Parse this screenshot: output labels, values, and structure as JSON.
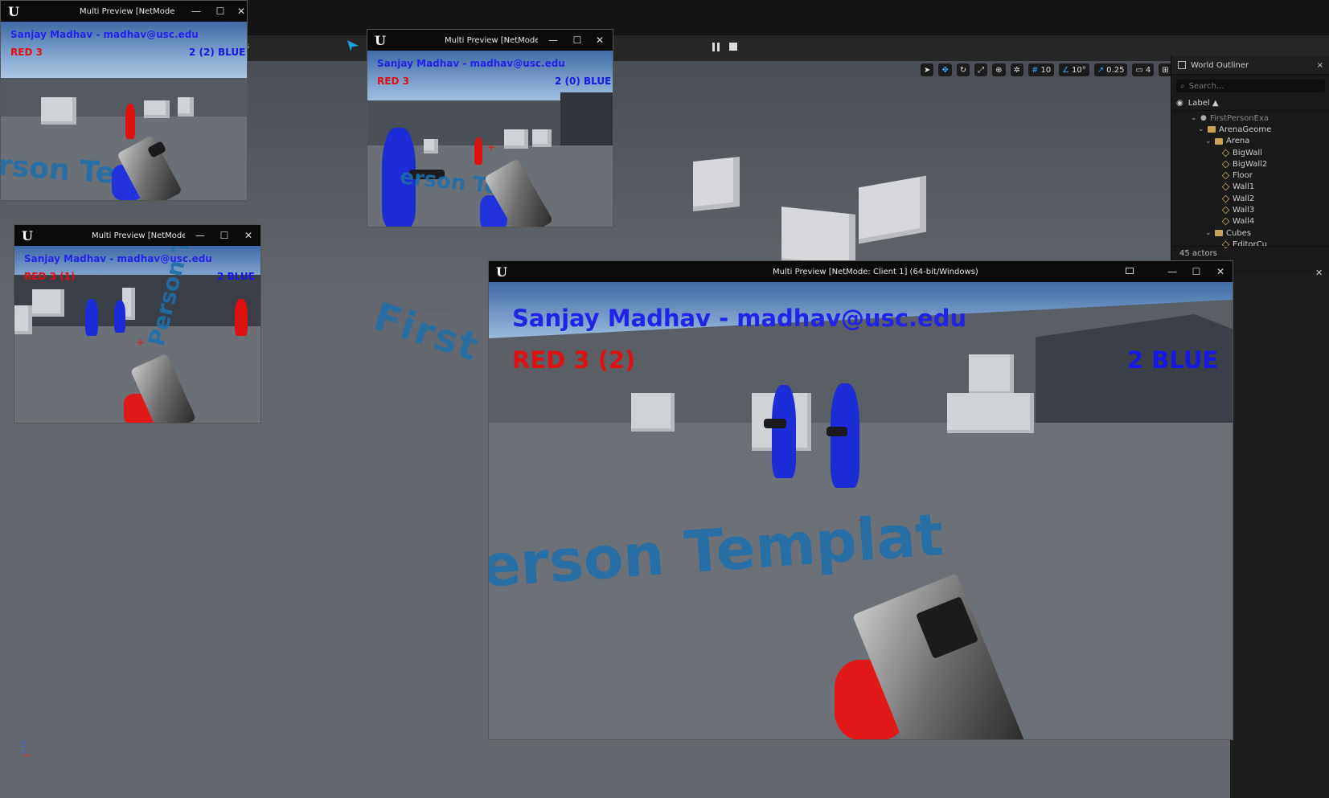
{
  "editor": {
    "toolbar": {
      "tab_fragment": "s",
      "pause_icon": "pause-icon",
      "stop_icon": "stop-icon"
    },
    "viewport": {
      "floor_text": "First P",
      "tools": {
        "grid_snap": "10",
        "rotation_snap": "10°",
        "scale_snap": "0.25",
        "camera_speed": "4"
      },
      "axis_z": "Z"
    },
    "outliner": {
      "title": "World Outliner",
      "close": "×",
      "search_placeholder": "Search...",
      "label_header": "Label ▲",
      "items": [
        {
          "label": "FirstPersonExa",
          "type": "world",
          "depth": 0,
          "expanded": true
        },
        {
          "label": "ArenaGeome",
          "type": "folder",
          "depth": 1,
          "expanded": true
        },
        {
          "label": "Arena",
          "type": "folder",
          "depth": 2,
          "expanded": true
        },
        {
          "label": "BigWall",
          "type": "mesh",
          "depth": 3
        },
        {
          "label": "BigWall2",
          "type": "mesh",
          "depth": 3
        },
        {
          "label": "Floor",
          "type": "mesh",
          "depth": 3
        },
        {
          "label": "Wall1",
          "type": "mesh",
          "depth": 3
        },
        {
          "label": "Wall2",
          "type": "mesh",
          "depth": 3
        },
        {
          "label": "Wall3",
          "type": "mesh",
          "depth": 3
        },
        {
          "label": "Wall4",
          "type": "mesh",
          "depth": 3
        },
        {
          "label": "Cubes",
          "type": "folder",
          "depth": 2,
          "expanded": true
        },
        {
          "label": "EditorCu",
          "type": "mesh",
          "depth": 3
        }
      ],
      "actor_count": "45 actors"
    }
  },
  "windows": {
    "w1": {
      "title": "Multi Preview [NetMode: Cli",
      "name": "Sanjay Madhav - madhav@usc.edu",
      "red": "RED  3",
      "blue": "2 (2)  BLUE",
      "floor_text": "rson Temp"
    },
    "w2": {
      "title": "Multi Preview [NetMode: Cli",
      "name": "Sanjay Madhav - madhav@usc.edu",
      "red": "RED  3",
      "blue": "2 (0)  BLUE",
      "floor_text": "erson Tem"
    },
    "w3": {
      "title": "Multi Preview [NetMode: Cli",
      "name": "Sanjay Madhav - madhav@usc.edu",
      "red": "RED  3 (1)",
      "blue": "2  BLUE",
      "floor_text": "Person Tem"
    },
    "w4": {
      "title": "Multi Preview [NetMode: Client 1]  (64-bit/Windows)",
      "name": "Sanjay Madhav - madhav@usc.edu",
      "red": "RED  3 (2)",
      "blue": "2  BLUE",
      "floor_text": "erson  Templat"
    }
  },
  "window_controls": {
    "minimize": "—",
    "maximize": "☐",
    "close": "✕"
  },
  "colors": {
    "hud_name": "#2323e8",
    "red_team": "#e01010",
    "blue_team": "#1616e6",
    "floor_text": "#1f6ea8"
  }
}
